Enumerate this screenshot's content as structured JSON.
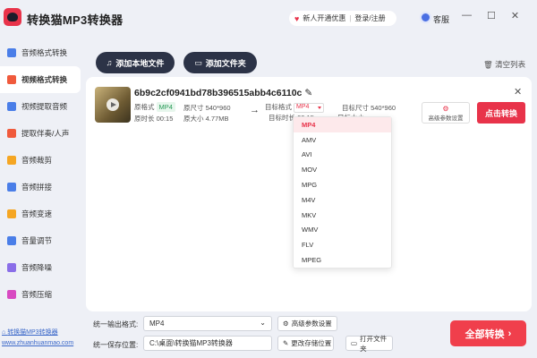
{
  "app": {
    "title": "转换猫MP3转换器"
  },
  "header": {
    "promo_label": "新人开通优惠",
    "login_label": "登录/注册",
    "service_label": "客服",
    "minimize": "—",
    "maximize": "☐",
    "close": "✕"
  },
  "sidebar": {
    "items": [
      {
        "label": "音频格式转换",
        "icon": "audio-convert-icon",
        "color": "#4a7ee8"
      },
      {
        "label": "视频格式转换",
        "icon": "video-convert-icon",
        "color": "#f05a3c"
      },
      {
        "label": "视频提取音频",
        "icon": "extract-audio-icon",
        "color": "#4a7ee8"
      },
      {
        "label": "提取伴奏/人声",
        "icon": "vocal-icon",
        "color": "#f05a3c"
      },
      {
        "label": "音频裁剪",
        "icon": "cut-icon",
        "color": "#f5a623"
      },
      {
        "label": "音频拼接",
        "icon": "merge-icon",
        "color": "#4a7ee8"
      },
      {
        "label": "音频变速",
        "icon": "speed-icon",
        "color": "#f5a623"
      },
      {
        "label": "音量调节",
        "icon": "volume-icon",
        "color": "#4a7ee8"
      },
      {
        "label": "音频降噪",
        "icon": "denoise-icon",
        "color": "#8a6ee8"
      },
      {
        "label": "音频压缩",
        "icon": "compress-icon",
        "color": "#d84ac2"
      }
    ],
    "active_index": 1
  },
  "toolbar": {
    "add_file_label": "添加本地文件",
    "add_folder_label": "添加文件夹",
    "clear_label": "清空列表"
  },
  "file": {
    "name": "6b9c2cf0941bd78b396515abb4c6110c",
    "orig_format_label": "原格式",
    "orig_format": "MP4",
    "orig_size_label": "原尺寸",
    "orig_size": "540*960",
    "orig_duration_label": "原时长",
    "orig_duration": "00:15",
    "orig_filesize_label": "原大小",
    "orig_filesize": "4.77MB",
    "target_format_label": "目标格式",
    "target_format": "MP4",
    "target_size_label": "目标尺寸",
    "target_size": "540*960",
    "target_duration_label": "目标时长",
    "target_duration": "00:15",
    "target_filesize_label": "目标大小",
    "adv_label": "高级参数设置",
    "convert_label": "点击转换"
  },
  "dropdown": {
    "options": [
      "MP4",
      "AMV",
      "AVI",
      "MOV",
      "MPG",
      "M4V",
      "MKV",
      "WMV",
      "FLV",
      "MPEG"
    ],
    "selected": "MP4"
  },
  "bottom": {
    "output_format_label": "统一输出格式:",
    "output_format": "MP4",
    "adv_label": "高级参数设置",
    "save_path_label": "统一保存位置:",
    "save_path": "C:\\桌面\\转换猫MP3转换器",
    "change_path_label": "更改存储位置",
    "open_folder_label": "打开文件夹",
    "all_convert_label": "全部转换"
  },
  "footer": {
    "link1": "转换猫MP3转换器",
    "link2": "www.zhuanhuanmao.com"
  },
  "colors": {
    "accent": "#e8334a",
    "dark": "#2c3347",
    "bg": "#eef0f6"
  }
}
